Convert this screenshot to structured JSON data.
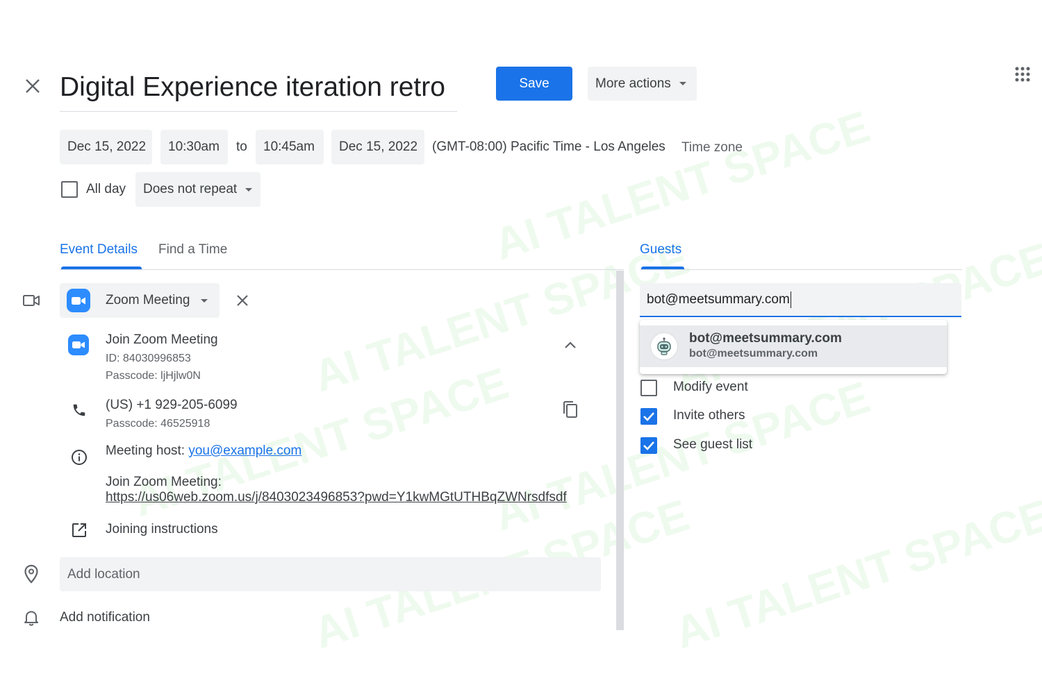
{
  "event": {
    "title": "Digital Experience iteration retro"
  },
  "toolbar": {
    "save_label": "Save",
    "more_actions_label": "More actions"
  },
  "datetime": {
    "start_date": "Dec 15, 2022",
    "start_time": "10:30am",
    "to_label": "to",
    "end_time": "10:45am",
    "end_date": "Dec 15, 2022",
    "timezone_text": "(GMT-08:00) Pacific Time - Los Angeles",
    "timezone_button": "Time zone",
    "all_day_label": "All day",
    "all_day_checked": false,
    "repeat_label": "Does not repeat"
  },
  "tabs": [
    {
      "label": "Event Details",
      "active": true
    },
    {
      "label": "Find a Time",
      "active": false
    }
  ],
  "conference": {
    "provider": "Zoom Meeting",
    "join_link_label": "Join Zoom Meeting",
    "meeting_id": "ID: 84030996853",
    "passcode": "Passcode: ljHjlw0N",
    "phone": "(US) +1 929-205-6099",
    "phone_passcode": "Passcode: 46525918",
    "host_label": "Meeting host:",
    "host_email": "you@example.com",
    "join_text": "Join Zoom Meeting:",
    "join_url": "https://us06web.zoom.us/j/8403023496853?pwd=Y1kwMGtUTHBqZWNrsdfsdf",
    "instructions_label": "Joining instructions"
  },
  "location": {
    "placeholder": "Add location"
  },
  "notification": {
    "label": "Add notification"
  },
  "guests": {
    "header": "Guests",
    "input_value": "bot@meetsummary.com",
    "suggestion": {
      "name": "bot@meetsummary.com",
      "email": "bot@meetsummary.com"
    },
    "permissions": [
      {
        "label": "Modify event",
        "checked": false
      },
      {
        "label": "Invite others",
        "checked": true
      },
      {
        "label": "See guest list",
        "checked": true
      }
    ]
  },
  "watermark": "AI TALENT SPACE",
  "colors": {
    "accent": "#1a73e8",
    "zoom": "#2d8cff",
    "chip_bg": "#f1f3f4"
  }
}
